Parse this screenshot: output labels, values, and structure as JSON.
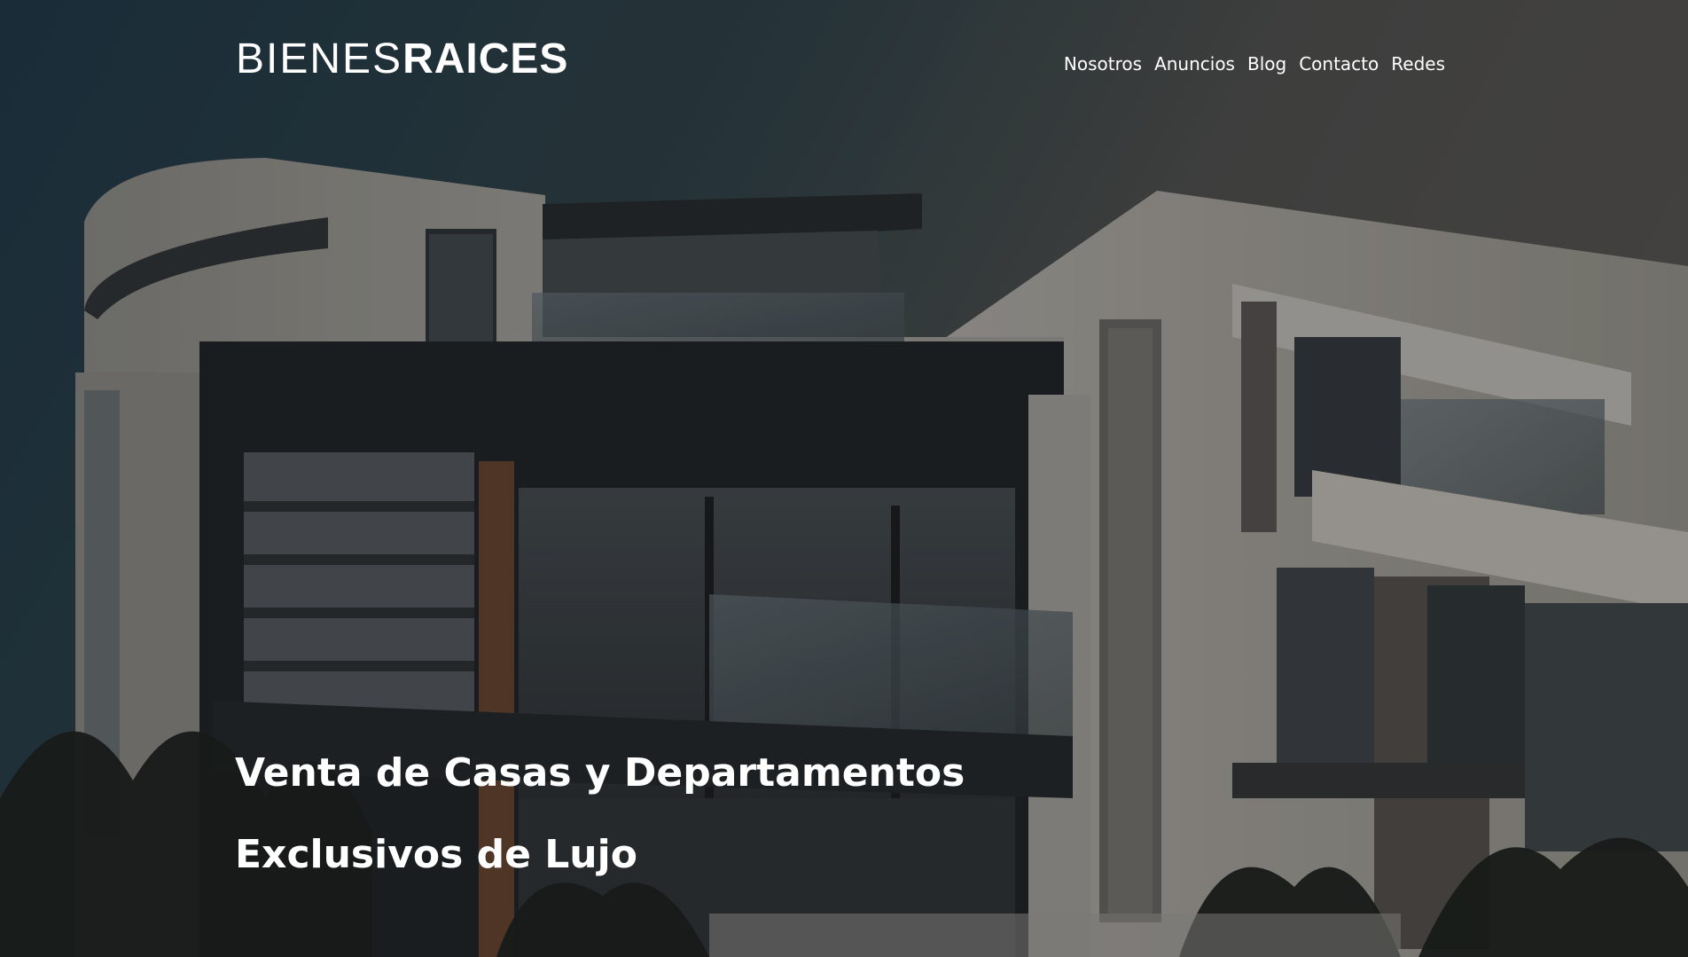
{
  "header": {
    "logo_light": "BIENES",
    "logo_bold": "RAICES",
    "nav": [
      {
        "label": "Nosotros"
      },
      {
        "label": "Anuncios"
      },
      {
        "label": "Blog"
      },
      {
        "label": "Contacto"
      },
      {
        "label": "Redes"
      }
    ]
  },
  "hero": {
    "headline_line1": "Venta de Casas y Departamentos",
    "headline_line2": "Exclusivos de Lujo"
  },
  "colors": {
    "text": "#ffffff",
    "sky_top": "#1f3340",
    "sky_right": "#4a4a4a"
  }
}
